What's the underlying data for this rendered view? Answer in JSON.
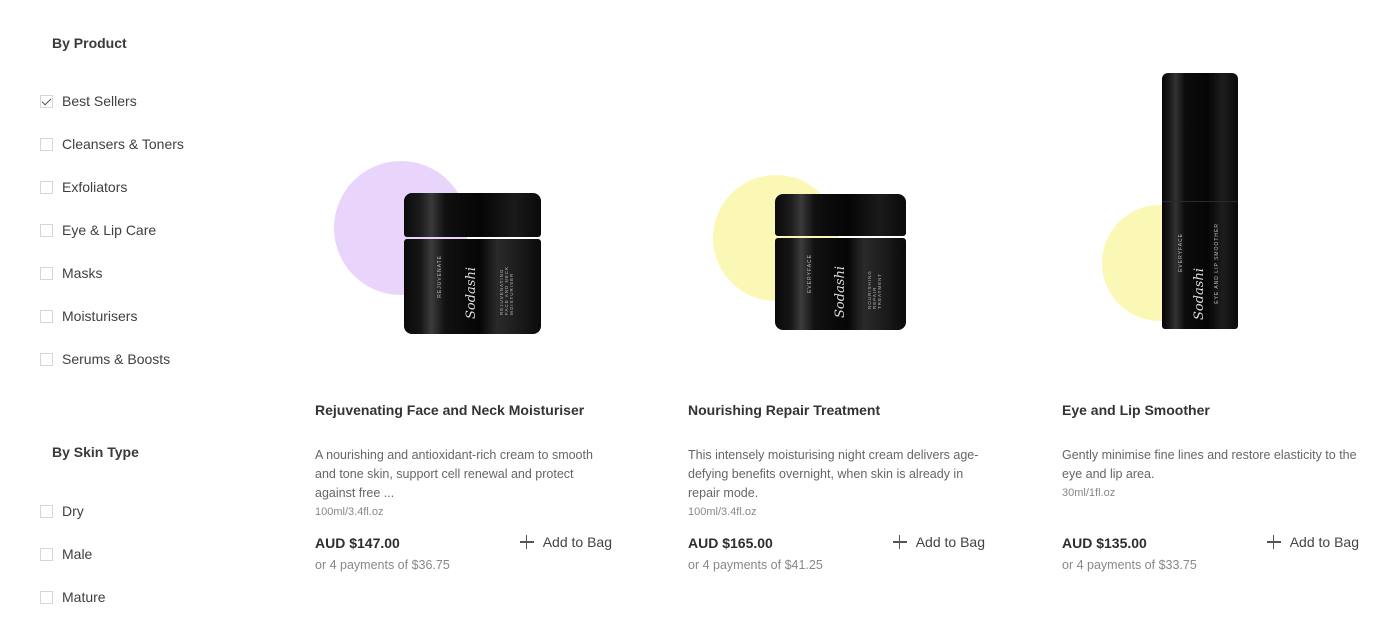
{
  "filters": {
    "by_product": {
      "title": "By Product",
      "items": [
        {
          "label": "Best Sellers",
          "checked": true
        },
        {
          "label": "Cleansers & Toners",
          "checked": false
        },
        {
          "label": "Exfoliators",
          "checked": false
        },
        {
          "label": "Eye & Lip Care",
          "checked": false
        },
        {
          "label": "Masks",
          "checked": false
        },
        {
          "label": "Moisturisers",
          "checked": false
        },
        {
          "label": "Serums & Boosts",
          "checked": false
        }
      ]
    },
    "by_skin_type": {
      "title": "By Skin Type",
      "items": [
        {
          "label": "Dry",
          "checked": false
        },
        {
          "label": "Male",
          "checked": false
        },
        {
          "label": "Mature",
          "checked": false
        }
      ]
    }
  },
  "products": [
    {
      "name": "Rejuvenating Face and Neck Moisturiser",
      "description": "A nourishing and antioxidant-rich cream to smooth and tone skin, support cell renewal and protect against free ...",
      "size": "100ml/3.4fl.oz",
      "price": "AUD $147.00",
      "payments": "or 4 payments of $36.75",
      "add_label": "Add to Bag",
      "accent_color": "#e9d5fb",
      "pack_line": "REJUVENATE",
      "pack_name": "REJUVENATING FACE AND NECK MOISTURISER",
      "brand_script": "Sodashi"
    },
    {
      "name": "Nourishing Repair Treatment",
      "description": "This intensely moisturising night cream delivers age-defying benefits overnight, when skin is already in repair mode.",
      "size": "100ml/3.4fl.oz",
      "price": "AUD $165.00",
      "payments": "or 4 payments of $41.25",
      "add_label": "Add to Bag",
      "accent_color": "#fbf7b4",
      "pack_line": "EVERYFACE",
      "pack_name": "NOURISHING REPAIR TREATMENT",
      "brand_script": "Sodashi"
    },
    {
      "name": "Eye and Lip Smoother",
      "description": "Gently minimise fine lines and restore elasticity to the eye and lip area.",
      "size": "30ml/1fl.oz",
      "price": "AUD $135.00",
      "payments": "or 4 payments of $33.75",
      "add_label": "Add to Bag",
      "accent_color": "#fbf7b4",
      "pack_line": "EVERYFACE",
      "pack_name": "EYE AND LIP SMOOTHER",
      "brand_script": "Sodashi"
    }
  ]
}
